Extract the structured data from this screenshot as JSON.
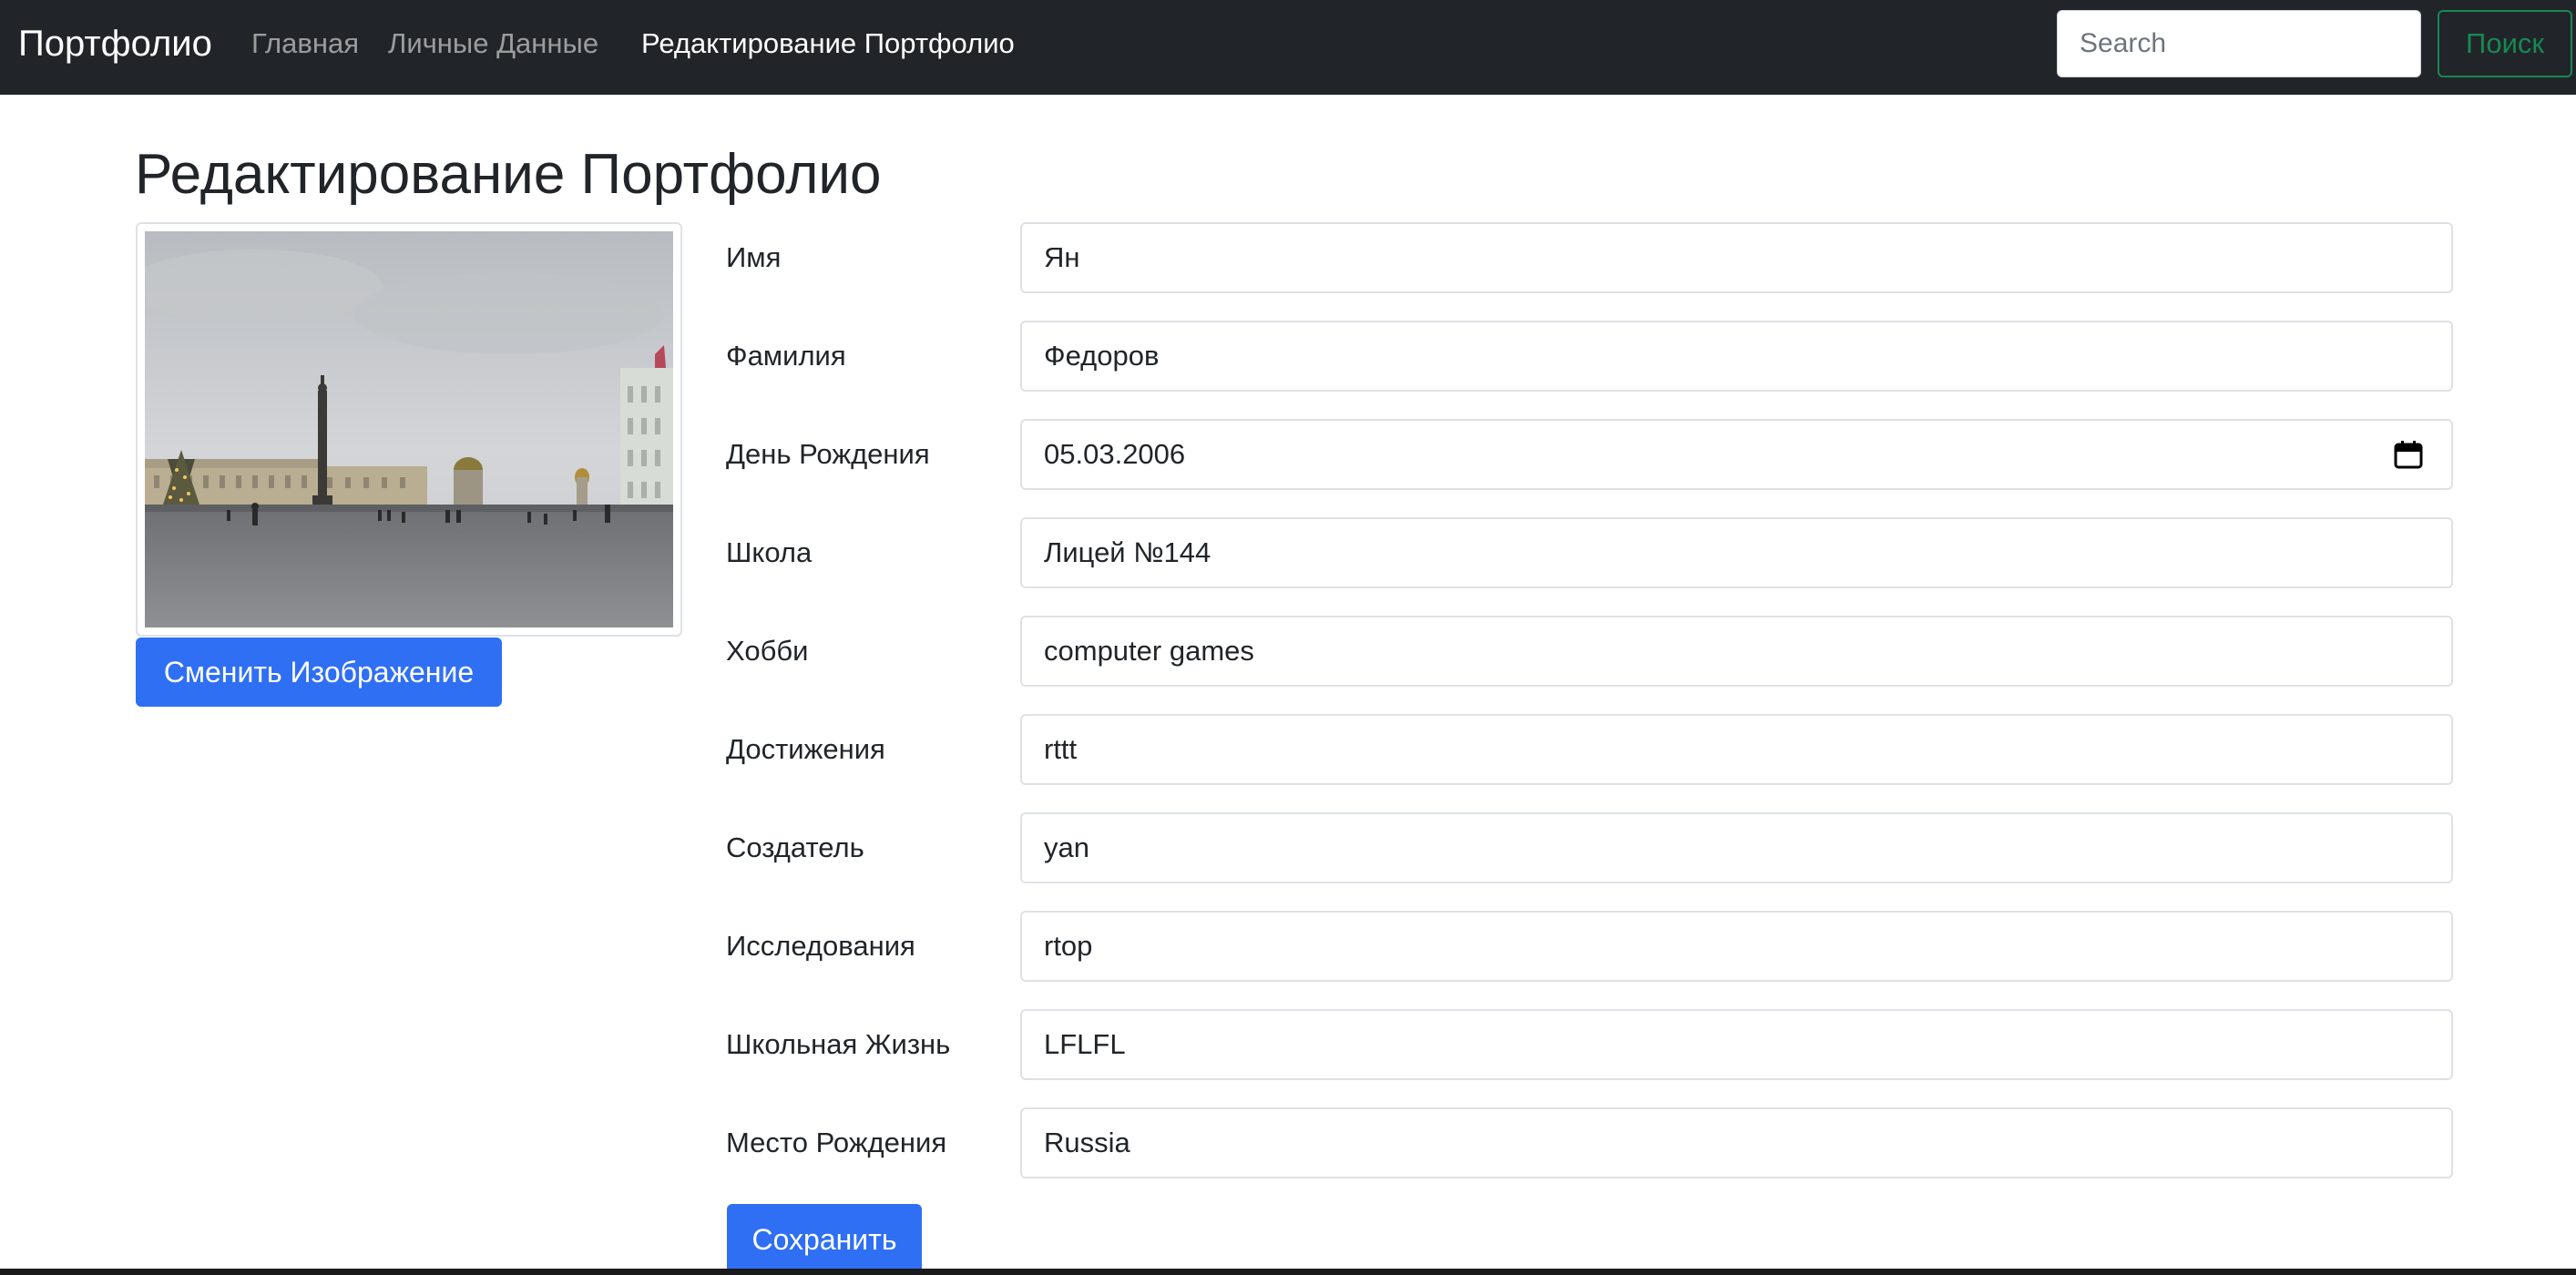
{
  "navbar": {
    "brand": "Портфолио",
    "links": [
      {
        "label": "Главная",
        "active": false
      },
      {
        "label": "Личные Данные",
        "active": false
      },
      {
        "label": "Редактирование Портфолио",
        "active": true
      }
    ],
    "search_placeholder": "Search",
    "search_button": "Поиск"
  },
  "page": {
    "title": "Редактирование Портфолио"
  },
  "image_panel": {
    "change_button": "Сменить Изображение"
  },
  "form": {
    "fields": [
      {
        "label": "Имя",
        "value": "Ян"
      },
      {
        "label": "Фамилия",
        "value": "Федоров"
      },
      {
        "label": "День Рождения",
        "value": "05.03.2006"
      },
      {
        "label": "Школа",
        "value": "Лицей №144"
      },
      {
        "label": "Хобби",
        "value": "computer games"
      },
      {
        "label": "Достижения",
        "value": "rttt"
      },
      {
        "label": "Создатель",
        "value": "yan"
      },
      {
        "label": "Исследования",
        "value": "rtop"
      },
      {
        "label": "Школьная Жизнь",
        "value": "LFLFL"
      },
      {
        "label": "Место Рождения",
        "value": "Russia"
      }
    ],
    "save_button": "Сохранить"
  },
  "colors": {
    "navbar_bg": "#212529",
    "primary": "#2f6ff4",
    "success": "#198754"
  },
  "icons": {
    "date_field": "calendar-icon"
  }
}
